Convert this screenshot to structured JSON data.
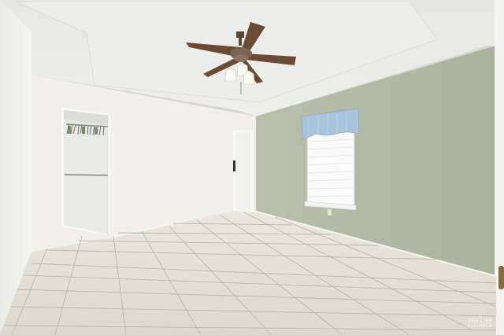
{
  "scene": {
    "description_label": "",
    "colors": {
      "ceiling": "#e9e9e6",
      "left_wall": "#f2f2f0",
      "back_wall": "#f0efec",
      "green_wall": "#b4bba6",
      "floor": "#e4e0d5",
      "grout": "#b9b3a5",
      "fan_wood": "#6a4a32",
      "valance": "#a9c3da"
    }
  },
  "watermark": {
    "text": "GREATER ALLIANCE"
  }
}
